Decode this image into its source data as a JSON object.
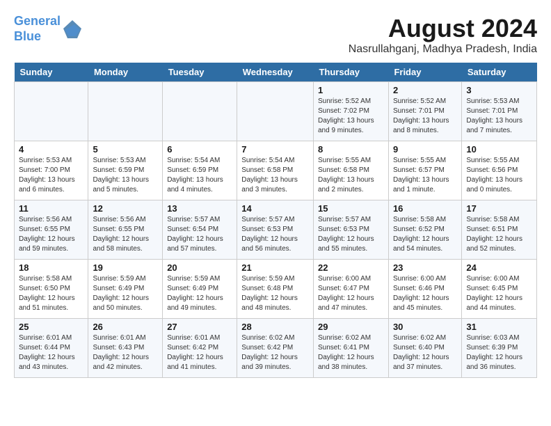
{
  "logo": {
    "line1": "General",
    "line2": "Blue"
  },
  "title": {
    "month_year": "August 2024",
    "location": "Nasrullahganj, Madhya Pradesh, India"
  },
  "headers": [
    "Sunday",
    "Monday",
    "Tuesday",
    "Wednesday",
    "Thursday",
    "Friday",
    "Saturday"
  ],
  "weeks": [
    [
      {
        "day": "",
        "info": ""
      },
      {
        "day": "",
        "info": ""
      },
      {
        "day": "",
        "info": ""
      },
      {
        "day": "",
        "info": ""
      },
      {
        "day": "1",
        "info": "Sunrise: 5:52 AM\nSunset: 7:02 PM\nDaylight: 13 hours\nand 9 minutes."
      },
      {
        "day": "2",
        "info": "Sunrise: 5:52 AM\nSunset: 7:01 PM\nDaylight: 13 hours\nand 8 minutes."
      },
      {
        "day": "3",
        "info": "Sunrise: 5:53 AM\nSunset: 7:01 PM\nDaylight: 13 hours\nand 7 minutes."
      }
    ],
    [
      {
        "day": "4",
        "info": "Sunrise: 5:53 AM\nSunset: 7:00 PM\nDaylight: 13 hours\nand 6 minutes."
      },
      {
        "day": "5",
        "info": "Sunrise: 5:53 AM\nSunset: 6:59 PM\nDaylight: 13 hours\nand 5 minutes."
      },
      {
        "day": "6",
        "info": "Sunrise: 5:54 AM\nSunset: 6:59 PM\nDaylight: 13 hours\nand 4 minutes."
      },
      {
        "day": "7",
        "info": "Sunrise: 5:54 AM\nSunset: 6:58 PM\nDaylight: 13 hours\nand 3 minutes."
      },
      {
        "day": "8",
        "info": "Sunrise: 5:55 AM\nSunset: 6:58 PM\nDaylight: 13 hours\nand 2 minutes."
      },
      {
        "day": "9",
        "info": "Sunrise: 5:55 AM\nSunset: 6:57 PM\nDaylight: 13 hours\nand 1 minute."
      },
      {
        "day": "10",
        "info": "Sunrise: 5:55 AM\nSunset: 6:56 PM\nDaylight: 13 hours\nand 0 minutes."
      }
    ],
    [
      {
        "day": "11",
        "info": "Sunrise: 5:56 AM\nSunset: 6:55 PM\nDaylight: 12 hours\nand 59 minutes."
      },
      {
        "day": "12",
        "info": "Sunrise: 5:56 AM\nSunset: 6:55 PM\nDaylight: 12 hours\nand 58 minutes."
      },
      {
        "day": "13",
        "info": "Sunrise: 5:57 AM\nSunset: 6:54 PM\nDaylight: 12 hours\nand 57 minutes."
      },
      {
        "day": "14",
        "info": "Sunrise: 5:57 AM\nSunset: 6:53 PM\nDaylight: 12 hours\nand 56 minutes."
      },
      {
        "day": "15",
        "info": "Sunrise: 5:57 AM\nSunset: 6:53 PM\nDaylight: 12 hours\nand 55 minutes."
      },
      {
        "day": "16",
        "info": "Sunrise: 5:58 AM\nSunset: 6:52 PM\nDaylight: 12 hours\nand 54 minutes."
      },
      {
        "day": "17",
        "info": "Sunrise: 5:58 AM\nSunset: 6:51 PM\nDaylight: 12 hours\nand 52 minutes."
      }
    ],
    [
      {
        "day": "18",
        "info": "Sunrise: 5:58 AM\nSunset: 6:50 PM\nDaylight: 12 hours\nand 51 minutes."
      },
      {
        "day": "19",
        "info": "Sunrise: 5:59 AM\nSunset: 6:49 PM\nDaylight: 12 hours\nand 50 minutes."
      },
      {
        "day": "20",
        "info": "Sunrise: 5:59 AM\nSunset: 6:49 PM\nDaylight: 12 hours\nand 49 minutes."
      },
      {
        "day": "21",
        "info": "Sunrise: 5:59 AM\nSunset: 6:48 PM\nDaylight: 12 hours\nand 48 minutes."
      },
      {
        "day": "22",
        "info": "Sunrise: 6:00 AM\nSunset: 6:47 PM\nDaylight: 12 hours\nand 47 minutes."
      },
      {
        "day": "23",
        "info": "Sunrise: 6:00 AM\nSunset: 6:46 PM\nDaylight: 12 hours\nand 45 minutes."
      },
      {
        "day": "24",
        "info": "Sunrise: 6:00 AM\nSunset: 6:45 PM\nDaylight: 12 hours\nand 44 minutes."
      }
    ],
    [
      {
        "day": "25",
        "info": "Sunrise: 6:01 AM\nSunset: 6:44 PM\nDaylight: 12 hours\nand 43 minutes."
      },
      {
        "day": "26",
        "info": "Sunrise: 6:01 AM\nSunset: 6:43 PM\nDaylight: 12 hours\nand 42 minutes."
      },
      {
        "day": "27",
        "info": "Sunrise: 6:01 AM\nSunset: 6:42 PM\nDaylight: 12 hours\nand 41 minutes."
      },
      {
        "day": "28",
        "info": "Sunrise: 6:02 AM\nSunset: 6:42 PM\nDaylight: 12 hours\nand 39 minutes."
      },
      {
        "day": "29",
        "info": "Sunrise: 6:02 AM\nSunset: 6:41 PM\nDaylight: 12 hours\nand 38 minutes."
      },
      {
        "day": "30",
        "info": "Sunrise: 6:02 AM\nSunset: 6:40 PM\nDaylight: 12 hours\nand 37 minutes."
      },
      {
        "day": "31",
        "info": "Sunrise: 6:03 AM\nSunset: 6:39 PM\nDaylight: 12 hours\nand 36 minutes."
      }
    ]
  ]
}
